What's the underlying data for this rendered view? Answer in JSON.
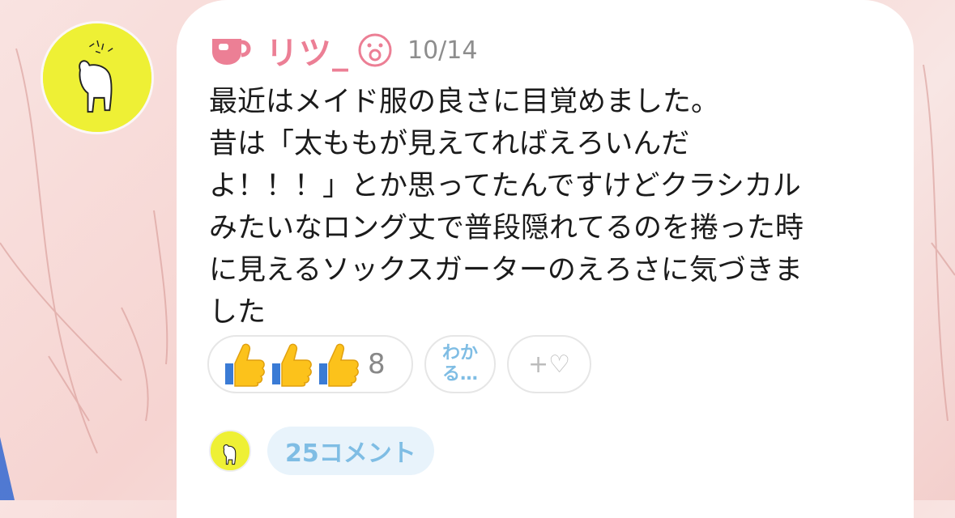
{
  "post": {
    "author": "リツ_",
    "date": "10/14",
    "body_lines": [
      "最近はメイド服の良さに目覚めました。",
      "昔は「太ももが見えてればえろいんだ",
      "よ！！！」とか思ってたんですけどクラシカル",
      "みたいなロング丈で普段隠れてるのを捲った時",
      "に見えるソックスガーターのえろさに気づきま",
      "した"
    ]
  },
  "reactions": {
    "thumbs_count": "8",
    "wakaru_label": "わか\nる…",
    "wakaru_line1": "わか",
    "wakaru_line2": "る…",
    "add_label": "+♡"
  },
  "footer": {
    "comment_label": "25コメント"
  },
  "colors": {
    "username": "#ec7f95",
    "accent_blue": "#7fbde4",
    "avatar_bg": "#eef035"
  },
  "icons": {
    "author_badge": "cup-icon",
    "mood": "smiley-icon",
    "reaction": "thumbs-up-icon",
    "add": "heart-icon"
  }
}
